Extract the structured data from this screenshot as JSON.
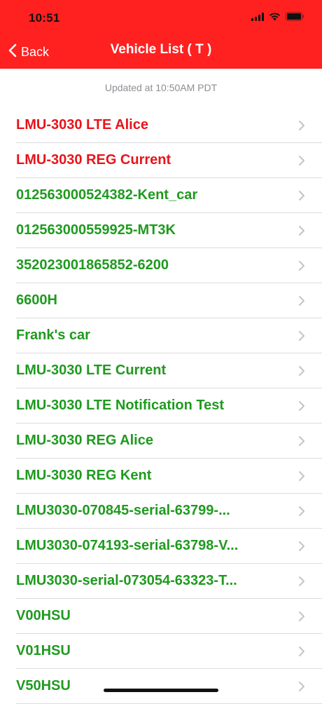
{
  "status_bar": {
    "time": "10:51"
  },
  "nav": {
    "back_label": "Back",
    "title": "Vehicle List ( T )"
  },
  "updated_text": "Updated at 10:50AM PDT",
  "colors": {
    "header": "#ff2020",
    "red_item": "#e8141b",
    "green_item": "#1f9a1f",
    "chevron": "#c4c4c7"
  },
  "vehicles": [
    {
      "label": "LMU-3030 LTE Alice",
      "status": "red"
    },
    {
      "label": "LMU-3030 REG Current",
      "status": "red"
    },
    {
      "label": "012563000524382-Kent_car",
      "status": "green"
    },
    {
      "label": "012563000559925-MT3K",
      "status": "green"
    },
    {
      "label": "352023001865852-6200",
      "status": "green"
    },
    {
      "label": "6600H",
      "status": "green"
    },
    {
      "label": "Frank's car",
      "status": "green"
    },
    {
      "label": "LMU-3030 LTE Current",
      "status": "green"
    },
    {
      "label": "LMU-3030 LTE Notification Test",
      "status": "green"
    },
    {
      "label": "LMU-3030 REG Alice",
      "status": "green"
    },
    {
      "label": "LMU-3030 REG Kent",
      "status": "green"
    },
    {
      "label": "LMU3030-070845-serial-63799-...",
      "status": "green"
    },
    {
      "label": "LMU3030-074193-serial-63798-V...",
      "status": "green"
    },
    {
      "label": "LMU3030-serial-073054-63323-T...",
      "status": "green"
    },
    {
      "label": "V00HSU",
      "status": "green"
    },
    {
      "label": "V01HSU",
      "status": "green"
    },
    {
      "label": "V50HSU",
      "status": "green"
    }
  ]
}
